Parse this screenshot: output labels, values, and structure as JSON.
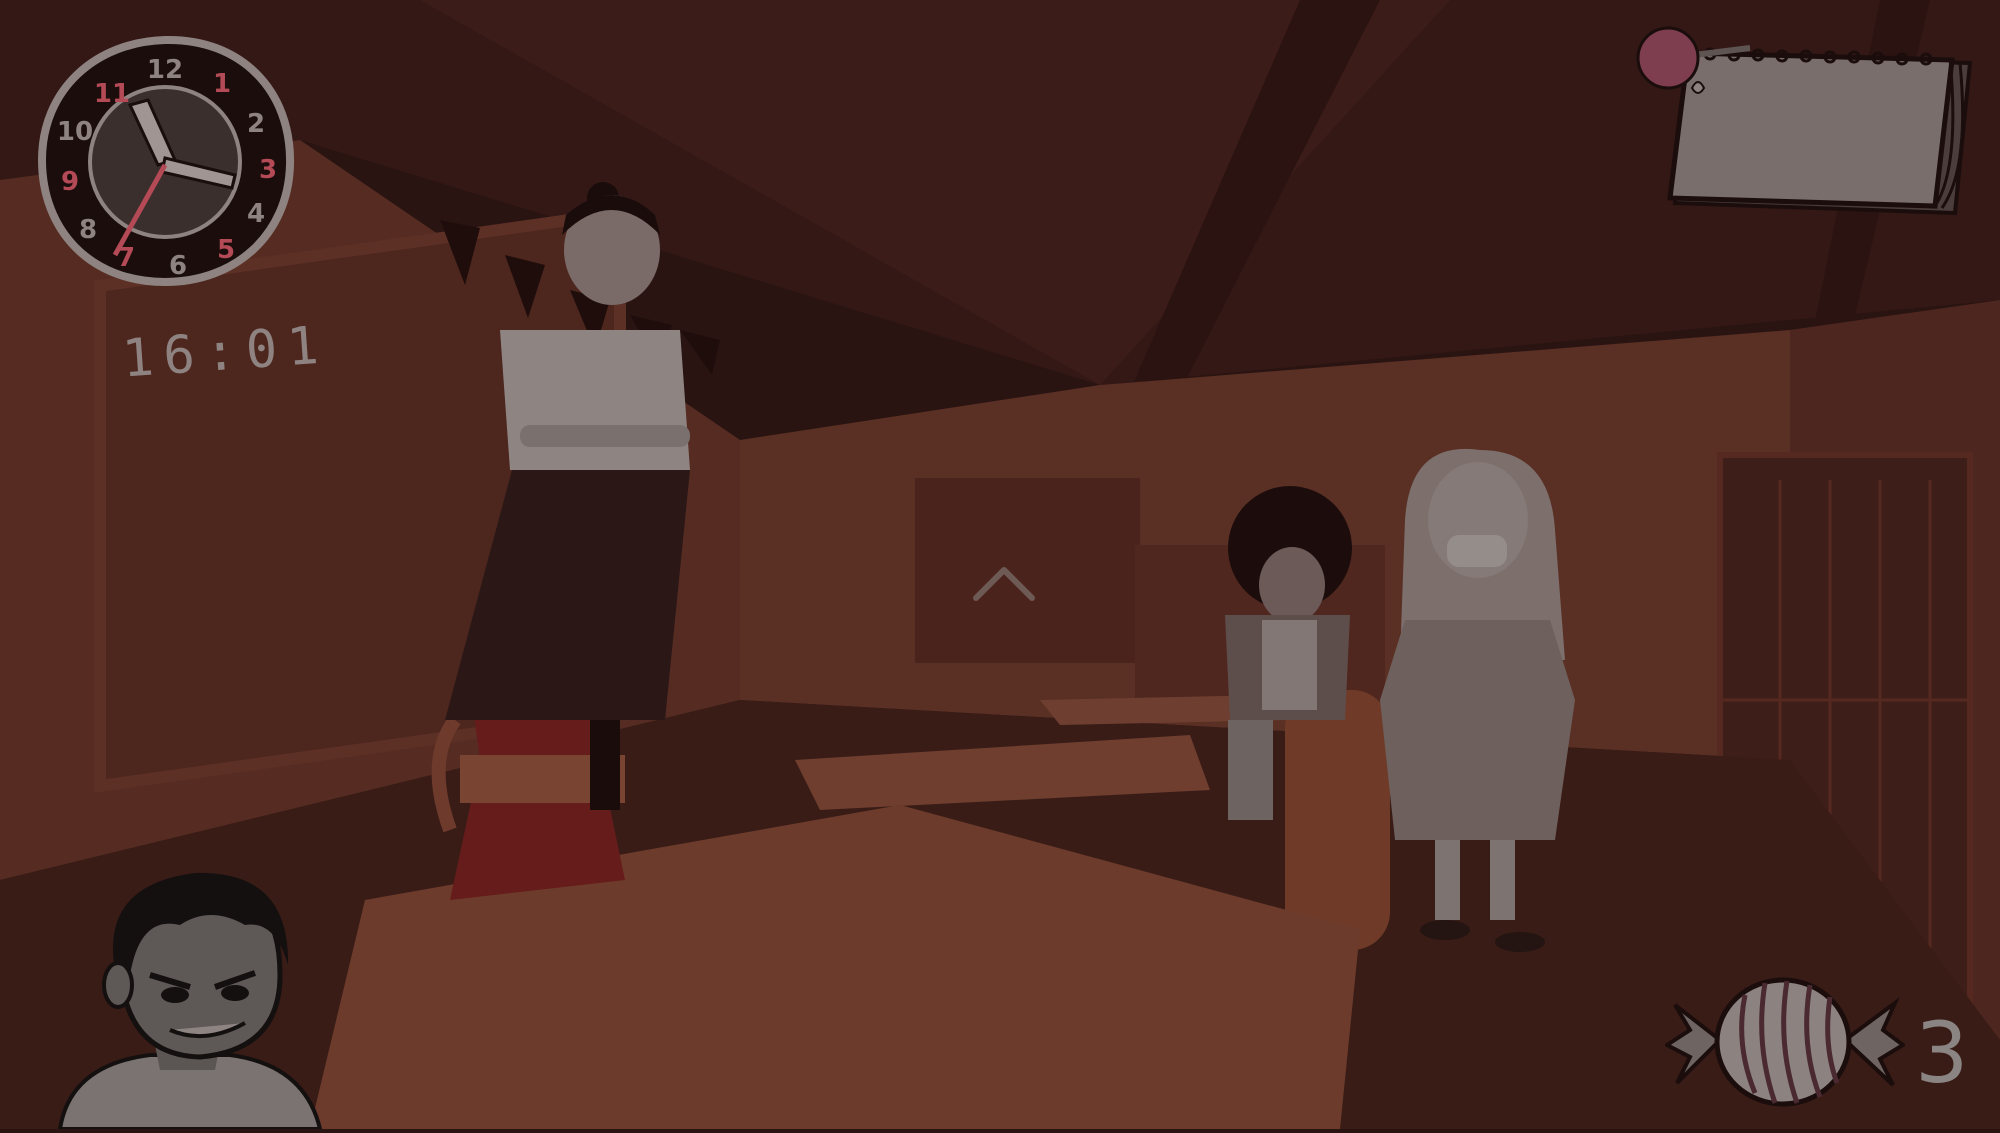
{
  "hud": {
    "clock": {
      "time_text": "16:01",
      "dial_numbers": [
        "12",
        "1",
        "2",
        "3",
        "4",
        "5",
        "6",
        "7",
        "8",
        "9",
        "10",
        "11"
      ],
      "icon": "analog-clock-icon"
    },
    "notebook": {
      "icon": "notepad-icon"
    },
    "candy": {
      "count": "3",
      "icon": "candy-icon"
    },
    "player_portrait": {
      "icon": "player-portrait"
    },
    "navigation": {
      "icon": "chevron-up-icon"
    }
  },
  "colors": {
    "scene_tint": "#2a1412",
    "wall": "#5e3125",
    "ceiling": "#3a1b17",
    "table": "#6a3a2b",
    "coffee_pot": "#6b1e1c",
    "ui_ink": "#8e8380"
  }
}
